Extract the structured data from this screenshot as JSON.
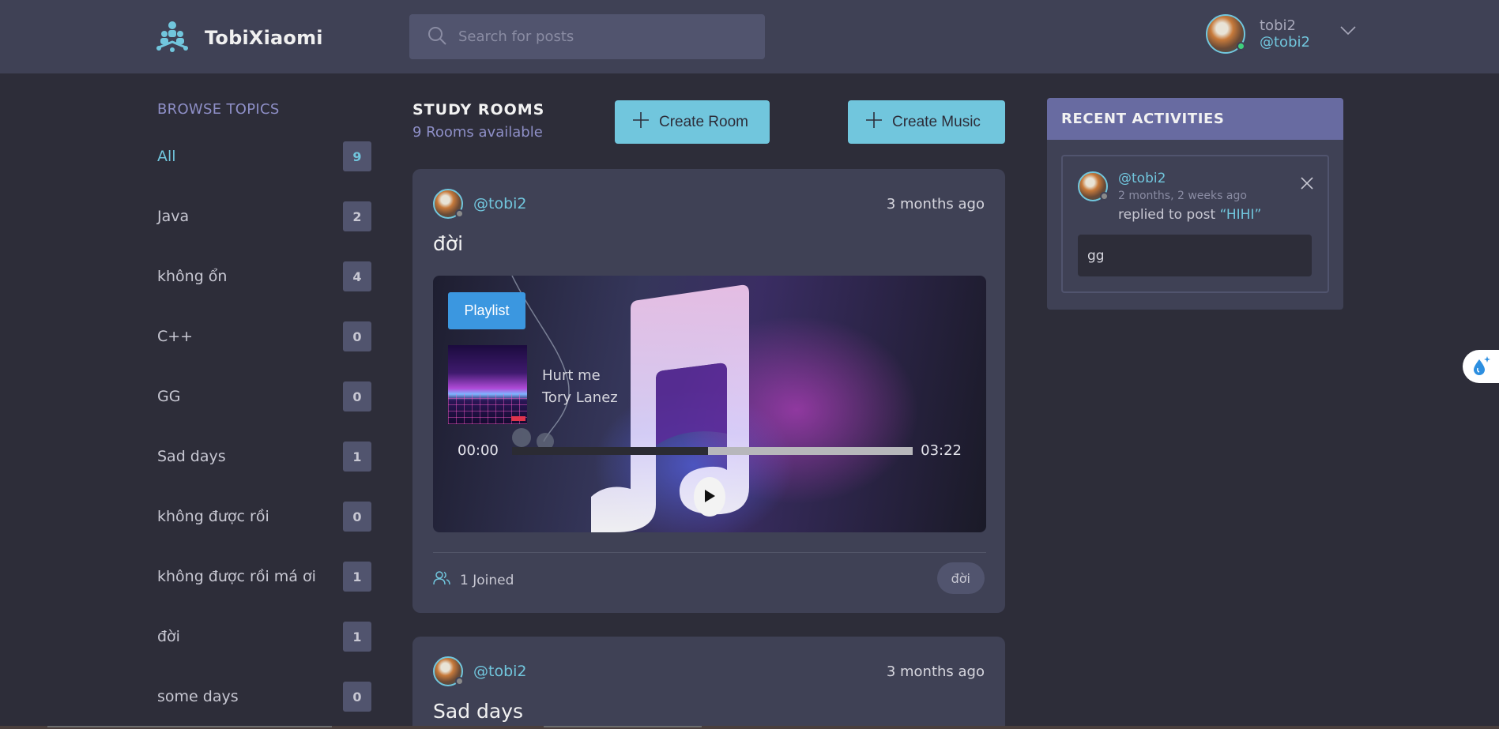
{
  "header": {
    "app_name": "TobiXiaomi",
    "logo_icon": "people-group-icon",
    "search_placeholder": "Search for posts",
    "user": {
      "name": "tobi2",
      "handle": "@tobi2",
      "status": "online"
    }
  },
  "sidebar": {
    "title": "BROWSE TOPICS",
    "topics": [
      {
        "label": "All",
        "count": "9",
        "active": true
      },
      {
        "label": "Java",
        "count": "2"
      },
      {
        "label": "không ổn",
        "count": "4"
      },
      {
        "label": "C++",
        "count": "0"
      },
      {
        "label": "GG",
        "count": "0"
      },
      {
        "label": "Sad days",
        "count": "1"
      },
      {
        "label": "không được rồi",
        "count": "0"
      },
      {
        "label": "không được rồi má ơi",
        "count": "1"
      },
      {
        "label": "đời",
        "count": "1"
      },
      {
        "label": "some days",
        "count": "0"
      }
    ]
  },
  "main": {
    "title": "STUDY ROOMS",
    "subtitle": "9 Rooms available",
    "create_room_label": "Create Room",
    "create_music_label": "Create Music",
    "rooms": [
      {
        "handle": "@tobi2",
        "time": "3 months ago",
        "title": "đời",
        "player": {
          "playlist_label": "Playlist",
          "song_title": "Hurt me",
          "artist": "Tory Lanez",
          "current_time": "00:00",
          "duration": "03:22",
          "progress": 0.49
        },
        "joined": "1 Joined",
        "topic": "đời"
      },
      {
        "handle": "@tobi2",
        "time": "3 months ago",
        "title": "Sad days"
      }
    ]
  },
  "activities": {
    "title": "RECENT ACTIVITIES",
    "items": [
      {
        "handle": "@tobi2",
        "time": "2 months, 2 weeks ago",
        "action": "replied to post",
        "post": "“HIHI”",
        "reply": "gg"
      }
    ]
  },
  "colors": {
    "background": "#2d2d39",
    "panel": "#3f4155",
    "accent": "#71c6dd",
    "activity_header": "#686ba1",
    "playlist_button": "#3b97e0"
  }
}
